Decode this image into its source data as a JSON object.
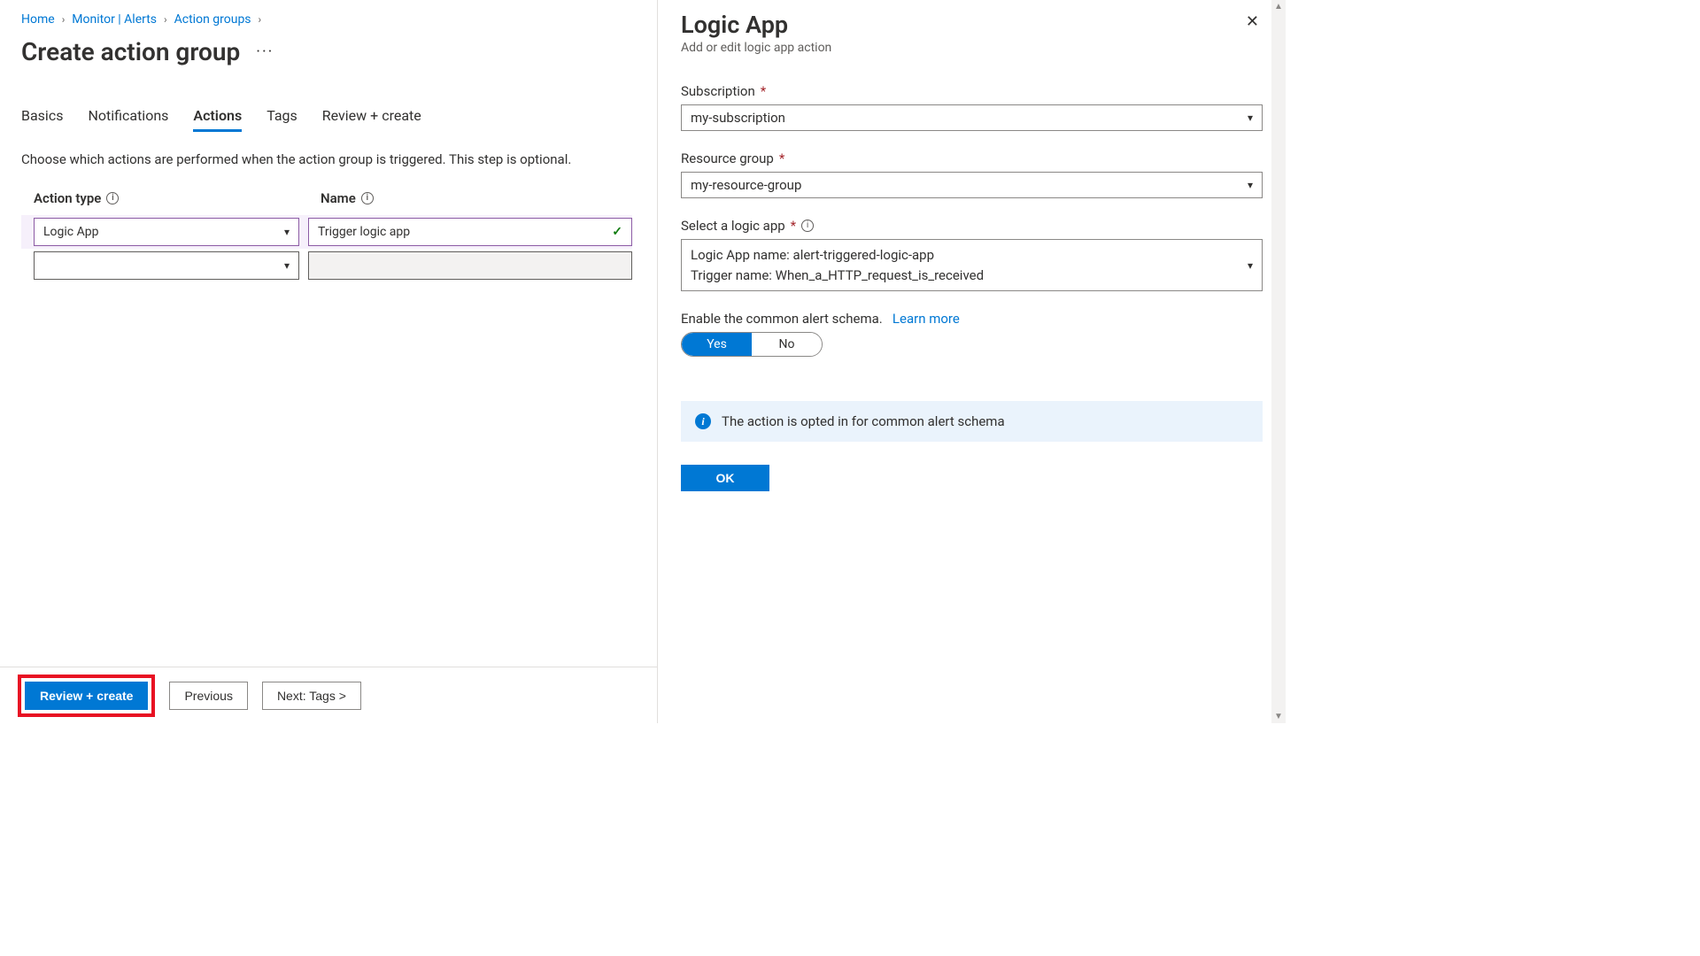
{
  "breadcrumb": {
    "items": [
      "Home",
      "Monitor | Alerts",
      "Action groups"
    ]
  },
  "page": {
    "title": "Create action group"
  },
  "tabs": {
    "items": [
      "Basics",
      "Notifications",
      "Actions",
      "Tags",
      "Review + create"
    ],
    "activeIndex": 2
  },
  "description": "Choose which actions are performed when the action group is triggered. This step is optional.",
  "table": {
    "headers": {
      "actionType": "Action type",
      "name": "Name"
    },
    "rows": [
      {
        "actionType": "Logic App",
        "name": "Trigger logic app",
        "validated": true
      }
    ]
  },
  "footer": {
    "reviewCreate": "Review + create",
    "previous": "Previous",
    "next": "Next: Tags >"
  },
  "panel": {
    "title": "Logic App",
    "subtitle": "Add or edit logic app action",
    "fields": {
      "subscription": {
        "label": "Subscription",
        "value": "my-subscription",
        "required": true
      },
      "resourceGroup": {
        "label": "Resource group",
        "value": "my-resource-group",
        "required": true
      },
      "logicApp": {
        "label": "Select a logic app",
        "required": true,
        "line1": "Logic App name: alert-triggered-logic-app",
        "line2": "Trigger name: When_a_HTTP_request_is_received"
      }
    },
    "schema": {
      "label": "Enable the common alert schema.",
      "learnMore": "Learn more",
      "toggle": {
        "on": "Yes",
        "off": "No",
        "value": "Yes"
      }
    },
    "banner": "The action is opted in for common alert schema",
    "ok": "OK"
  }
}
